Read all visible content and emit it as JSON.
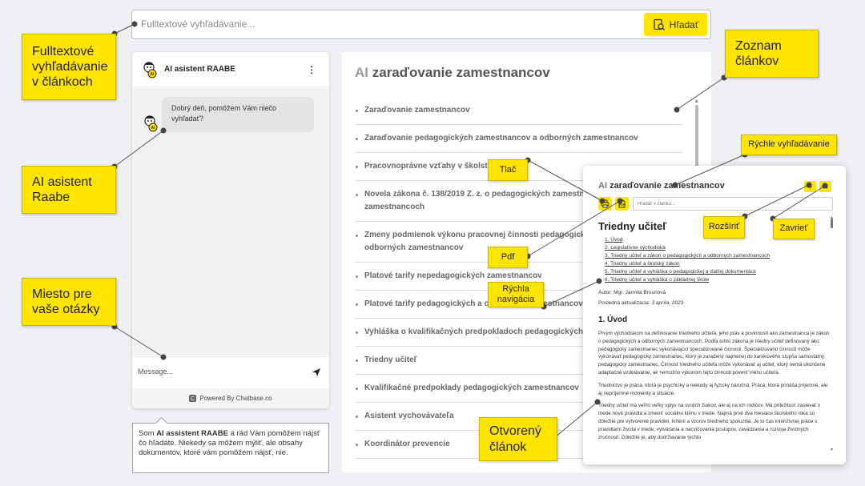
{
  "search": {
    "placeholder": "Fulltextové vyhľadávanie...",
    "button_label": "Hľadať"
  },
  "chat": {
    "title": "AI asistent RAABE",
    "greeting": "Dobrý deň, pomôžem Vám niečo vyhľadať?",
    "message_placeholder": "Message...",
    "footer": "Powered By Chatbase.co"
  },
  "note": {
    "strong": "AI assistent RAABE",
    "prefix": "Som ",
    "suffix": " a rád Vám pomôžem nájsť čo hľadáte. Niekedy sa môžem mýliť, ale obsahy dokumentov, ktoré vám pomôžem nájsť, nie."
  },
  "article_list": {
    "title_ai": "AI",
    "title_rest": "zaraďovanie zamestnancov",
    "items": [
      "Zaraďovanie zamestnancov",
      "Zaraďovanie pedagogických zamestnancov a odborných zamestnancov",
      "Pracovnoprávne vzťahy v školstve",
      "Novela zákona č. 138/2019 Z. z. o pedagogických zamestnancoch a odborných zamestnancoch",
      "Zmeny podmienok výkonu pracovnej činnosti pedagogických zamestnancov a odborných zamestnancov",
      "Platové tarify nepedagogických zamestnancov",
      "Platové tarify pedagogických a odborných zamestnancov",
      "Vyhláška o kvalifikačných predpokladoch pedagogických zamestnancov",
      "Triedny učiteľ",
      "Kvalifikačné predpoklady pedagogických zamestnancov",
      "Asistent vychovávateľa",
      "Koordinátor prevencie"
    ]
  },
  "popup": {
    "title_ai": "AI",
    "title_rest": "zaraďovanie zamestnancov",
    "search_placeholder": "Hľadať v článku...",
    "expand_label": "+",
    "close_label": "✕",
    "heading": "Triedny učiteľ",
    "toc": [
      "1. Úvod",
      "2. Legislatívne východiská",
      "3. Triedny učiteľ a zákon o pedagogických a odborných zamestnancoch",
      "4. Triedny učiteľ a školský zákon",
      "5. Triedny učiteľ a vyhláška o pedagogickej a ďalšej dokumentácii",
      "6. Triedny učiteľ a vyhláška o základnej škole"
    ],
    "author": "Autor: Mgr. Jarmila Brounová",
    "updated_label": "Posledná aktualizácia: ",
    "updated_date": "3 apríla. 2023",
    "section_heading": "1. Úvod",
    "paragraphs": [
      "Prvým východiskom na definovanie triedneho učiteľa, jeho práv a povinností ako zamestnanca je zákon o pedagogických a odborných zamestnancoch. Podľa tohto zákona je triedny učiteľ definovaný ako pedagogický zamestnanec vykonávajúci špecializované činnosti. Špecializovanú činnosti môže vykonávať pedagogický zamestnanec, ktorý je zaradený najmenej do kariérového stupňa samostatný pedagogický zamestnanec. Činnosť triedneho učiteľa môže vykonávať aj učiteľ, ktorý nemá ukončené adaptačné vzdelávanie, ak nemožno výkonom tejto činnosti poveriť iného učiteľa.",
      "Triednictvo je práca, ktorá je psychicky a niekedy aj fyzicky náročná. Práca, ktorá prináša príjemné, ale aj nepríjemné momenty a situácie.",
      "Triedny učiteľ má veľmi veľký vplyv na svojich žiakov, ale aj na ich rodičov. Má príležitosť zasievať v triede nové pravidlá a zmeniť sociálnu klímu v triede. Najmä prvé dva mesiace školského roka sú dôležité pre vytvorenie pravidiel, kritérií a vzorov triedneho spoluzitia. Je to čas intenzívnej práce s pravidlami života v triede, vytvárania a nacvičovania postupov, zavádzania a rozvoja životných zručností. Dôležité je, aby dodržiavanie týchto"
    ]
  },
  "callouts": {
    "fulltext": "Fulltextové vyhľadávanie v článkoch",
    "assistant": "AI asistent Raabe",
    "question_place": "Miesto pre vaše otázky",
    "article_list": "Zoznam článkov",
    "quick_search": "Rýchle vyhľadávanie",
    "print": "Tlač",
    "pdf": "Pdf",
    "quick_nav": "Rýchla navigácia",
    "expand": "Rozšíriť",
    "close": "Zavrieť",
    "open_article": "Otvorený článok"
  },
  "colors": {
    "accent": "#ffe400",
    "background": "#eef0f4",
    "panel": "#ffffff"
  }
}
